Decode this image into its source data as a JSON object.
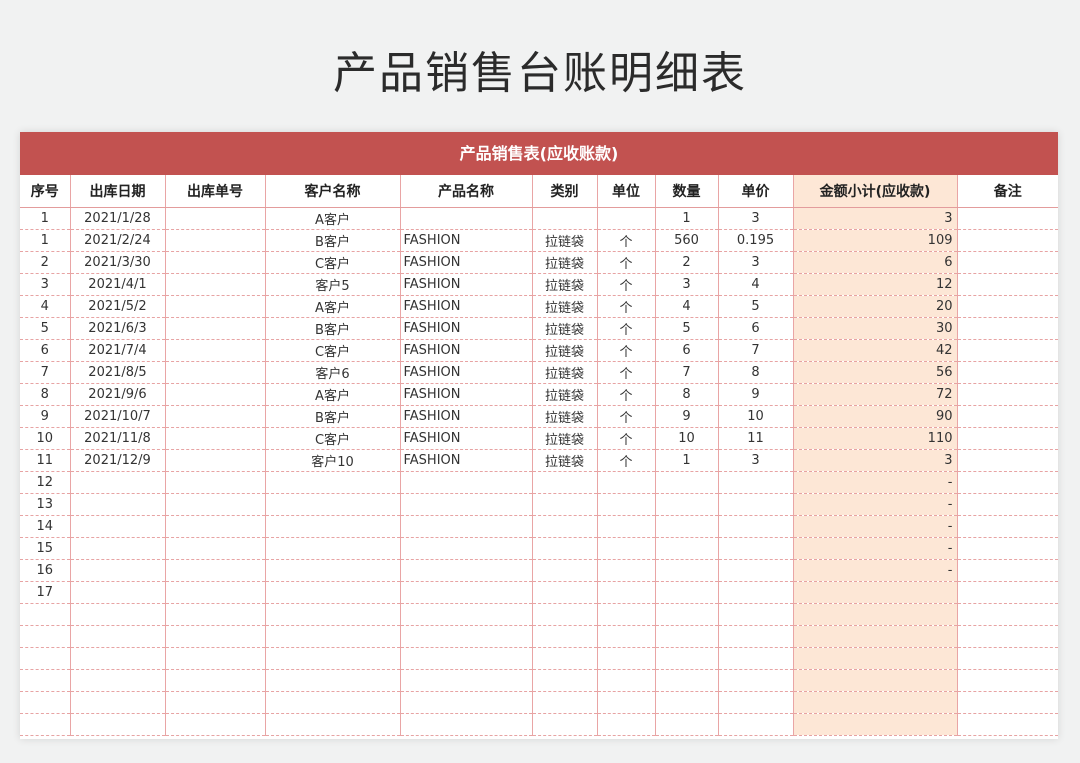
{
  "page": {
    "title": "产品销售台账明细表"
  },
  "sheet": {
    "header": "产品销售表(应收账款)",
    "columns": [
      "序号",
      "出库日期",
      "出库单号",
      "客户名称",
      "产品名称",
      "类别",
      "单位",
      "数量",
      "单价",
      "金额小计(应收款)",
      "备注"
    ],
    "rows": [
      [
        "1",
        "2021/1/28",
        "",
        "A客户",
        "",
        "",
        "",
        "1",
        "3",
        "3",
        ""
      ],
      [
        "1",
        "2021/2/24",
        "",
        "B客户",
        "FASHION",
        "拉链袋",
        "个",
        "560",
        "0.195",
        "109",
        ""
      ],
      [
        "2",
        "2021/3/30",
        "",
        "C客户",
        "FASHION",
        "拉链袋",
        "个",
        "2",
        "3",
        "6",
        ""
      ],
      [
        "3",
        "2021/4/1",
        "",
        "客户5",
        "FASHION",
        "拉链袋",
        "个",
        "3",
        "4",
        "12",
        ""
      ],
      [
        "4",
        "2021/5/2",
        "",
        "A客户",
        "FASHION",
        "拉链袋",
        "个",
        "4",
        "5",
        "20",
        ""
      ],
      [
        "5",
        "2021/6/3",
        "",
        "B客户",
        "FASHION",
        "拉链袋",
        "个",
        "5",
        "6",
        "30",
        ""
      ],
      [
        "6",
        "2021/7/4",
        "",
        "C客户",
        "FASHION",
        "拉链袋",
        "个",
        "6",
        "7",
        "42",
        ""
      ],
      [
        "7",
        "2021/8/5",
        "",
        "客户6",
        "FASHION",
        "拉链袋",
        "个",
        "7",
        "8",
        "56",
        ""
      ],
      [
        "8",
        "2021/9/6",
        "",
        "A客户",
        "FASHION",
        "拉链袋",
        "个",
        "8",
        "9",
        "72",
        ""
      ],
      [
        "9",
        "2021/10/7",
        "",
        "B客户",
        "FASHION",
        "拉链袋",
        "个",
        "9",
        "10",
        "90",
        ""
      ],
      [
        "10",
        "2021/11/8",
        "",
        "C客户",
        "FASHION",
        "拉链袋",
        "个",
        "10",
        "11",
        "110",
        ""
      ],
      [
        "11",
        "2021/12/9",
        "",
        "客户10",
        "FASHION",
        "拉链袋",
        "个",
        "1",
        "3",
        "3",
        ""
      ],
      [
        "12",
        "",
        "",
        "",
        "",
        "",
        "",
        "",
        "",
        "-",
        ""
      ],
      [
        "13",
        "",
        "",
        "",
        "",
        "",
        "",
        "",
        "",
        "-",
        ""
      ],
      [
        "14",
        "",
        "",
        "",
        "",
        "",
        "",
        "",
        "",
        "-",
        ""
      ],
      [
        "15",
        "",
        "",
        "",
        "",
        "",
        "",
        "",
        "",
        "-",
        ""
      ],
      [
        "16",
        "",
        "",
        "",
        "",
        "",
        "",
        "",
        "",
        "-",
        ""
      ],
      [
        "17",
        "",
        "",
        "",
        "",
        "",
        "",
        "",
        "",
        "",
        ""
      ],
      [
        "",
        "",
        "",
        "",
        "",
        "",
        "",
        "",
        "",
        "",
        ""
      ],
      [
        "",
        "",
        "",
        "",
        "",
        "",
        "",
        "",
        "",
        "",
        ""
      ],
      [
        "",
        "",
        "",
        "",
        "",
        "",
        "",
        "",
        "",
        "",
        ""
      ],
      [
        "",
        "",
        "",
        "",
        "",
        "",
        "",
        "",
        "",
        "",
        ""
      ],
      [
        "",
        "",
        "",
        "",
        "",
        "",
        "",
        "",
        "",
        "",
        ""
      ],
      [
        "",
        "",
        "",
        "",
        "",
        "",
        "",
        "",
        "",
        "",
        ""
      ]
    ]
  },
  "colors": {
    "header_bg": "#c25250",
    "amount_col_bg": "#fde7d6",
    "grid_line": "#e7a3a3"
  }
}
